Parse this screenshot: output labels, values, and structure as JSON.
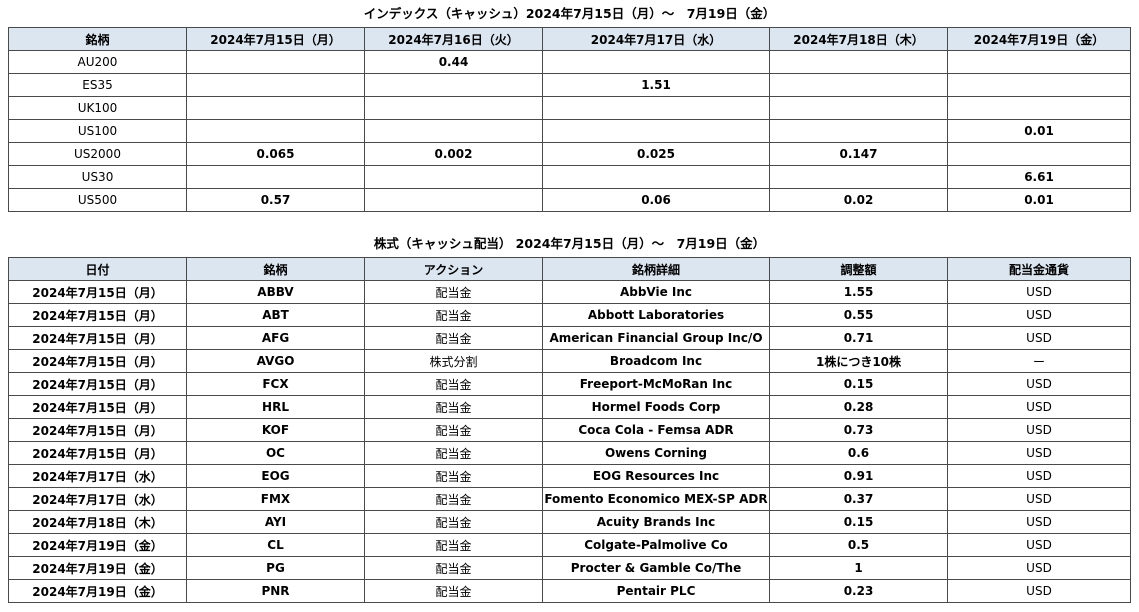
{
  "index_section": {
    "title": "インデックス（キャッシュ）2024年7月15日（月）～　7月19日（金）",
    "headers": [
      "銘柄",
      "2024年7月15日（月）",
      "2024年7月16日（火）",
      "2024年7月17日（水）",
      "2024年7月18日（木）",
      "2024年7月19日（金）"
    ],
    "rows": [
      [
        "AU200",
        "",
        "0.44",
        "",
        "",
        ""
      ],
      [
        "ES35",
        "",
        "",
        "1.51",
        "",
        ""
      ],
      [
        "UK100",
        "",
        "",
        "",
        "",
        ""
      ],
      [
        "US100",
        "",
        "",
        "",
        "",
        "0.01"
      ],
      [
        "US2000",
        "0.065",
        "0.002",
        "0.025",
        "0.147",
        ""
      ],
      [
        "US30",
        "",
        "",
        "",
        "",
        "6.61"
      ],
      [
        "US500",
        "0.57",
        "",
        "0.06",
        "0.02",
        "0.01"
      ]
    ]
  },
  "stock_section": {
    "title": "株式（キャッシュ配当） 2024年7月15日（月）～　7月19日（金）",
    "headers": [
      "日付",
      "銘柄",
      "アクション",
      "銘柄詳細",
      "調整額",
      "配当金通貨"
    ],
    "rows": [
      [
        "2024年7月15日（月）",
        "ABBV",
        "配当金",
        "AbbVie Inc",
        "1.55",
        "USD"
      ],
      [
        "2024年7月15日（月）",
        "ABT",
        "配当金",
        "Abbott Laboratories",
        "0.55",
        "USD"
      ],
      [
        "2024年7月15日（月）",
        "AFG",
        "配当金",
        "American Financial Group Inc/O",
        "0.71",
        "USD"
      ],
      [
        "2024年7月15日（月）",
        "AVGO",
        "株式分割",
        "Broadcom Inc",
        "1株につき10株",
        "ー"
      ],
      [
        "2024年7月15日（月）",
        "FCX",
        "配当金",
        "Freeport-McMoRan Inc",
        "0.15",
        "USD"
      ],
      [
        "2024年7月15日（月）",
        "HRL",
        "配当金",
        "Hormel Foods Corp",
        "0.28",
        "USD"
      ],
      [
        "2024年7月15日（月）",
        "KOF",
        "配当金",
        "Coca Cola - Femsa ADR",
        "0.73",
        "USD"
      ],
      [
        "2024年7月15日（月）",
        "OC",
        "配当金",
        "Owens Corning",
        "0.6",
        "USD"
      ],
      [
        "2024年7月17日（水）",
        "EOG",
        "配当金",
        "EOG Resources Inc",
        "0.91",
        "USD"
      ],
      [
        "2024年7月17日（水）",
        "FMX",
        "配当金",
        "Fomento Economico MEX-SP ADR",
        "0.37",
        "USD"
      ],
      [
        "2024年7月18日（木）",
        "AYI",
        "配当金",
        "Acuity Brands Inc",
        "0.15",
        "USD"
      ],
      [
        "2024年7月19日（金）",
        "CL",
        "配当金",
        "Colgate-Palmolive Co",
        "0.5",
        "USD"
      ],
      [
        "2024年7月19日（金）",
        "PG",
        "配当金",
        "Procter & Gamble Co/The",
        "1",
        "USD"
      ],
      [
        "2024年7月19日（金）",
        "PNR",
        "配当金",
        "Pentair PLC",
        "0.23",
        "USD"
      ]
    ]
  }
}
